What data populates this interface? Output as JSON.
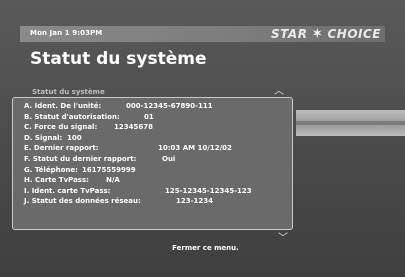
{
  "header": {
    "datetime": "Mon Jan 1  9:03PM",
    "brand_left": "STAR",
    "brand_right": "CHOICE",
    "title": "Statut du système"
  },
  "panel": {
    "subheader": "Statut du système",
    "rows": [
      {
        "label": "A. Ident. De l'unité:",
        "value": "000-12345-67890-111"
      },
      {
        "label": "B. Statut d'autorisation:",
        "value": "01"
      },
      {
        "label": "C. Force du signal:",
        "value": "12345678"
      },
      {
        "label": "D. Signal:",
        "value": "100"
      },
      {
        "label": "E. Dernier rapport:",
        "value": "10:03 AM 10/12/02"
      },
      {
        "label": "F. Statut du dernier rapport:",
        "value": "Oui"
      },
      {
        "label": "G. Téléphone:",
        "value": "16175559999"
      },
      {
        "label": "H. Carte TvPass:",
        "value": "N/A"
      },
      {
        "label": "I. Ident. carte TvPass:",
        "value": "125-12345-12345-123"
      },
      {
        "label": "J. Statut des données réseau:",
        "value": "123-1234"
      }
    ]
  },
  "footer": {
    "close_text": "Fermer ce menu."
  },
  "icons": {
    "scroll_up": "chevron-up-icon",
    "scroll_down": "chevron-down-icon",
    "brand_star": "star-icon"
  }
}
